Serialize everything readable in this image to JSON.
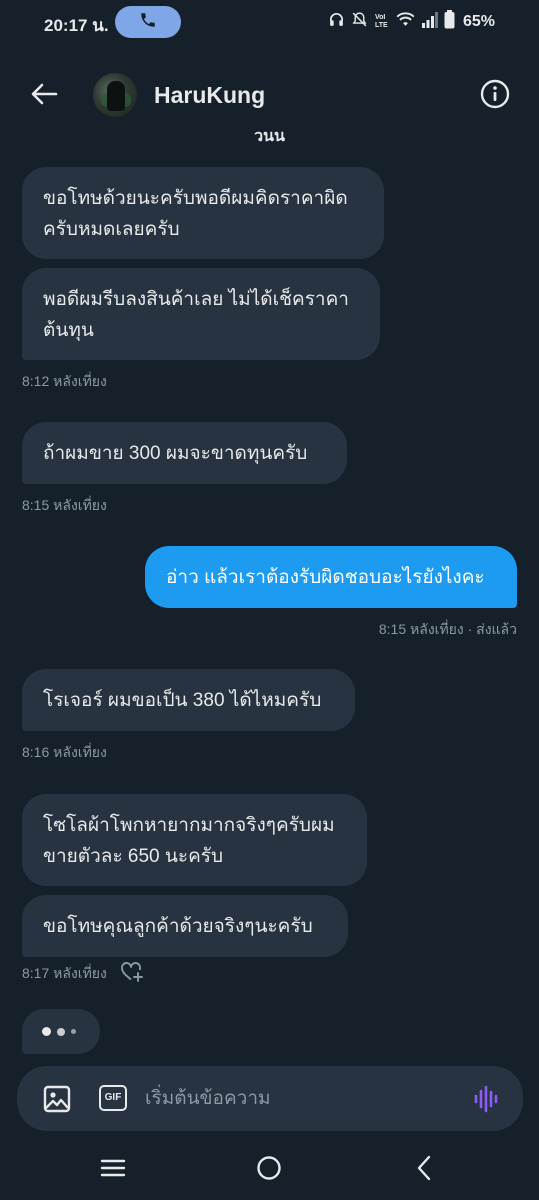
{
  "status_bar": {
    "time": "20:17 น.",
    "battery": "65%",
    "icons": [
      "phone-icon",
      "headphones-icon",
      "mute-icon",
      "volte-icon",
      "wifi-icon",
      "signal-icon",
      "battery-icon"
    ]
  },
  "header": {
    "contact_name": "HaruKung",
    "partial_text": "วนน",
    "icons": [
      "back-arrow-icon",
      "avatar",
      "info-icon"
    ]
  },
  "messages": [
    {
      "dir": "in",
      "text_lines": [
        "ขอโทษด้วยนะครับพอดีผมคิดราคาผิด",
        "ครับหมดเลยครับ"
      ]
    },
    {
      "dir": "in",
      "text_lines": [
        "พอดีผมรีบลงสินค้าเลย ไม่ได้เช็คราคา",
        "ต้นทุน"
      ]
    },
    {
      "type": "timestamp",
      "text": "8:12 หลังเที่ยง"
    },
    {
      "dir": "in",
      "text_lines": [
        "ถ้าผมขาย 300 ผมจะขาดทุนครับ"
      ]
    },
    {
      "type": "timestamp",
      "text": "8:15 หลังเที่ยง"
    },
    {
      "dir": "out",
      "text_lines": [
        "อ่าว แล้วเราต้องรับผิดชอบอะไรยังไงคะ"
      ]
    },
    {
      "type": "timestamp",
      "text": "8:15 หลังเที่ยง · ส่งแล้ว"
    },
    {
      "dir": "in",
      "text_lines": [
        "โรเจอร์ ผมขอเป็น 380 ได้ไหมครับ"
      ]
    },
    {
      "type": "timestamp",
      "text": "8:16 หลังเที่ยง"
    },
    {
      "dir": "in",
      "text_lines": [
        "โซโลผ้าโพกหายากมากจริงๆครับผม",
        "ขายตัวละ 650 นะครับ"
      ]
    },
    {
      "dir": "in",
      "text_lines": [
        "ขอโทษคุณลูกค้าด้วยจริงๆนะครับ"
      ]
    },
    {
      "type": "timestamp",
      "text": "8:17 หลังเที่ยง"
    }
  ],
  "composer": {
    "placeholder": "เริ่มต้นข้อความ",
    "gif_label": "GIF",
    "icons": [
      "image-icon",
      "gif-icon",
      "voice-wave-icon"
    ]
  },
  "navbar": {
    "icons": [
      "recents-icon",
      "home-icon",
      "back-icon"
    ]
  },
  "colors": {
    "background": "#15202b",
    "incoming_bubble": "#273340",
    "outgoing_bubble": "#1d9bf0",
    "timestamp": "#8b98a5",
    "voice_accent": "#8b5cf6"
  }
}
